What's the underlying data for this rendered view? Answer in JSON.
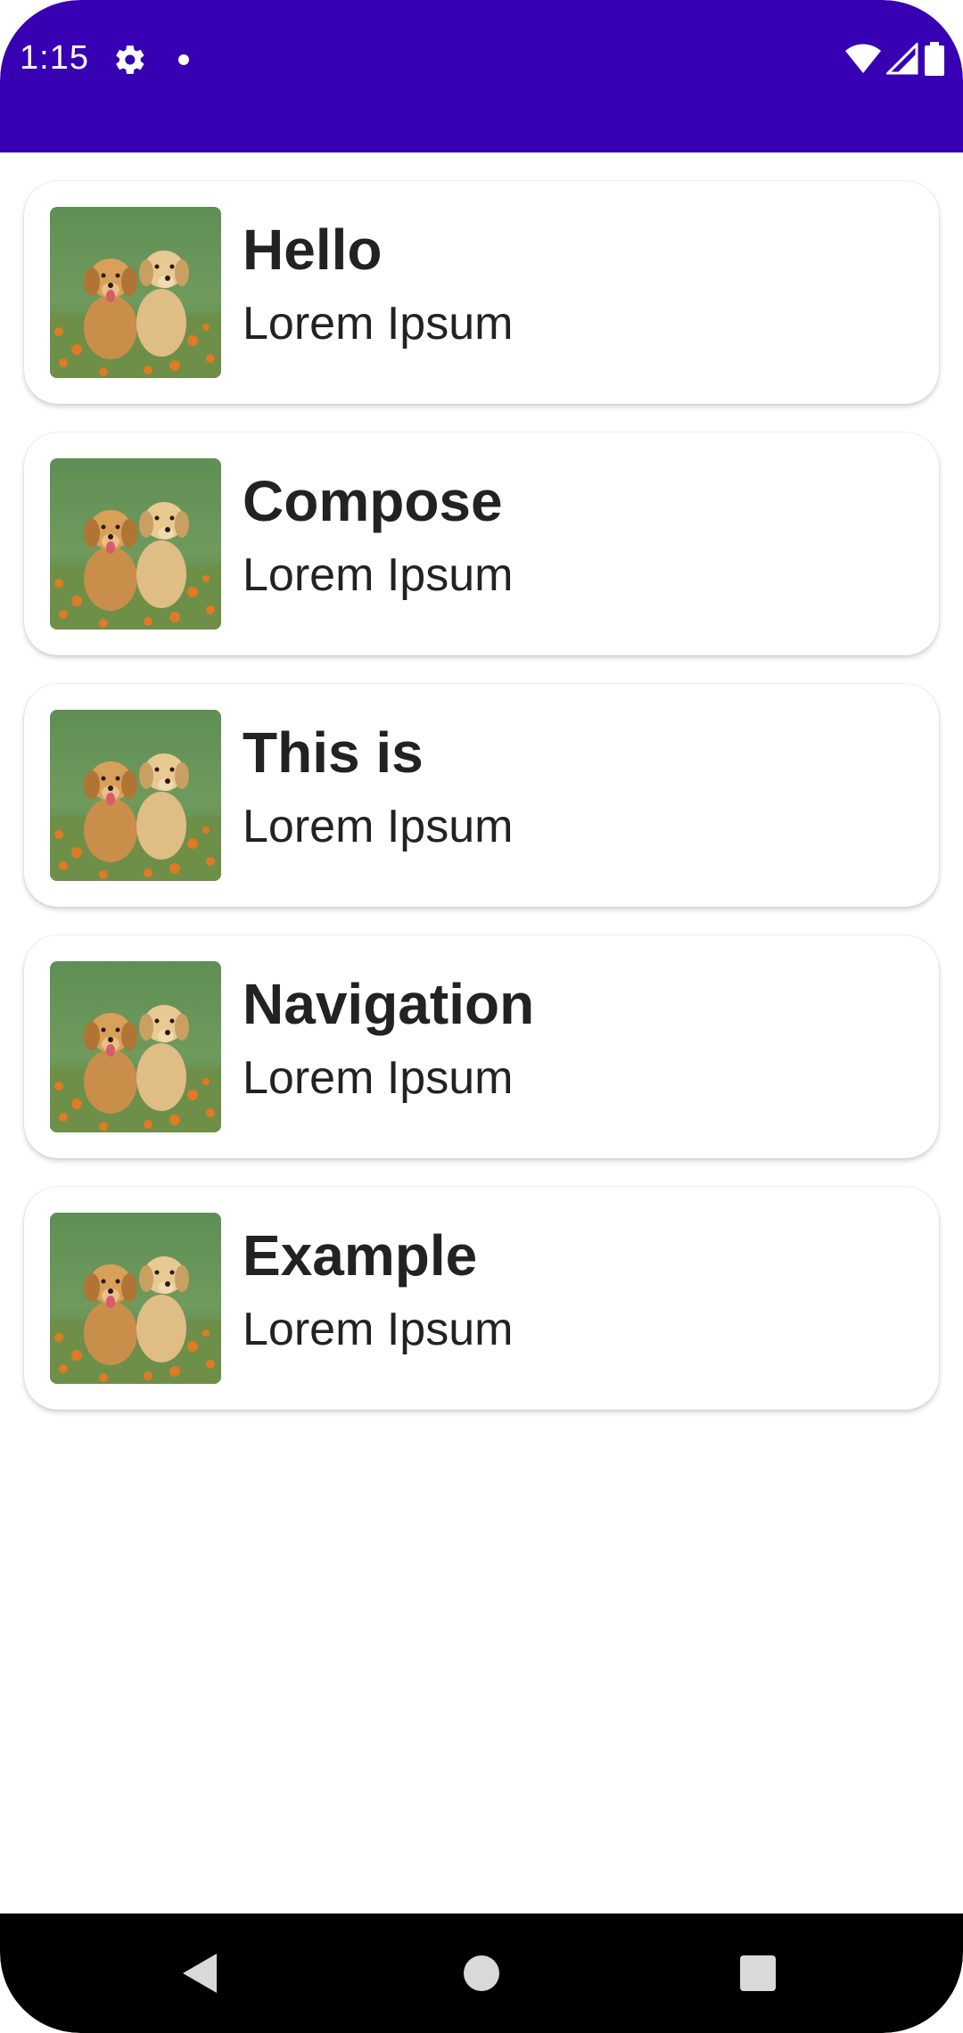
{
  "status_bar": {
    "time": "1:15",
    "icons": [
      "gear-icon",
      "notification-dot-icon",
      "wifi-icon",
      "cell-signal-icon",
      "battery-icon"
    ],
    "background": "#3700b3"
  },
  "list": {
    "items": [
      {
        "title": "Hello",
        "subtitle": "Lorem Ipsum",
        "image": "puppies-image"
      },
      {
        "title": "Compose",
        "subtitle": "Lorem Ipsum",
        "image": "puppies-image"
      },
      {
        "title": "This is",
        "subtitle": "Lorem Ipsum",
        "image": "puppies-image"
      },
      {
        "title": "Navigation",
        "subtitle": "Lorem Ipsum",
        "image": "puppies-image"
      },
      {
        "title": "Example",
        "subtitle": "Lorem Ipsum",
        "image": "puppies-image"
      }
    ]
  },
  "nav_bar": {
    "buttons": [
      "back-icon",
      "home-icon",
      "recents-icon"
    ]
  }
}
